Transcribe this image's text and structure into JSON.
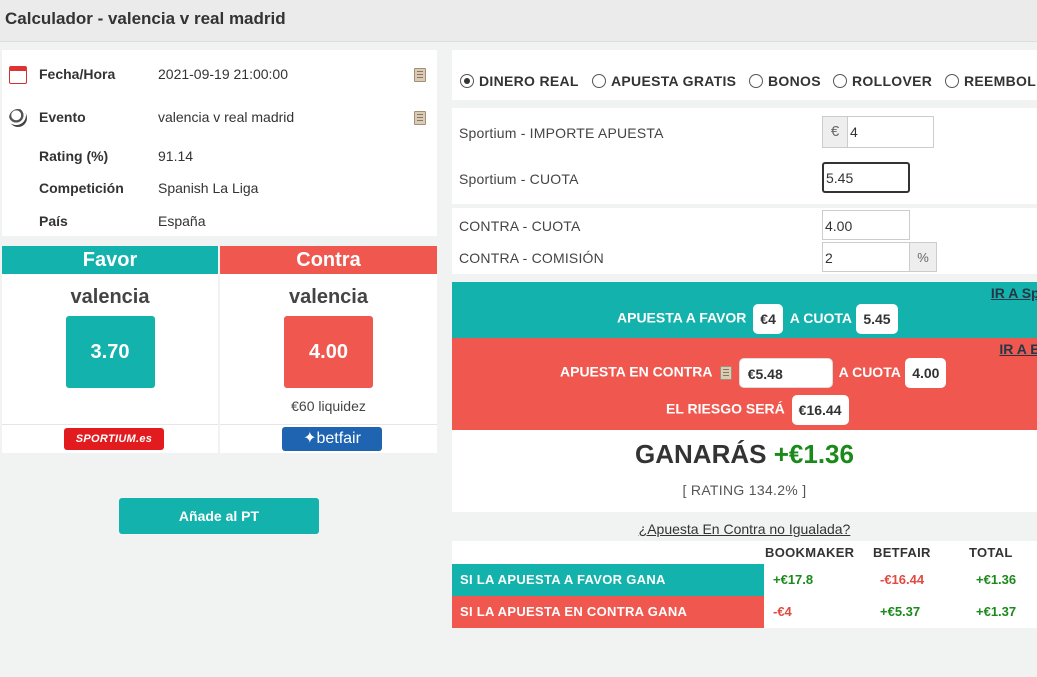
{
  "window": {
    "title": "Calculador - valencia v real madrid"
  },
  "info": {
    "fecha_label": "Fecha/Hora",
    "fecha_value": "2021-09-19 21:00:00",
    "evento_label": "Evento",
    "evento_value": "valencia v real madrid",
    "rating_label": "Rating (%)",
    "rating_value": "91.14",
    "competicion_label": "Competición",
    "competicion_value": "Spanish La Liga",
    "pais_label": "País",
    "pais_value": "España"
  },
  "favor": {
    "header": "Favor",
    "team": "valencia",
    "odd": "3.70",
    "bookmaker_logo": "SPORTIUM.es",
    "bookmaker_icon": "sportium-logo"
  },
  "contra": {
    "header": "Contra",
    "team": "valencia",
    "odd": "4.00",
    "liquidity": "€60 liquidez",
    "exchange_logo": "betfair",
    "exchange_icon": "betfair-logo"
  },
  "add_button": "Añade al PT",
  "modes": [
    {
      "label": "DINERO REAL",
      "selected": true
    },
    {
      "label": "APUESTA GRATIS",
      "selected": false
    },
    {
      "label": "BONOS",
      "selected": false
    },
    {
      "label": "ROLLOVER",
      "selected": false
    },
    {
      "label": "REEMBOL",
      "selected": false
    }
  ],
  "form": {
    "importe_label": "Sportium - IMPORTE APUESTA",
    "currency": "€",
    "importe_value": "4",
    "cuota_label": "Sportium - CUOTA",
    "cuota_value": "5.45",
    "contra_cuota_label": "CONTRA - CUOTA",
    "contra_cuota_value": "4.00",
    "comision_label": "CONTRA - COMISIÓN",
    "comision_value": "2",
    "comision_unit": "%"
  },
  "ir_sportium": {
    "link": "IR A Sportium",
    "favor_label": "APUESTA A FAVOR",
    "favor_stake": "€4",
    "cuota_label": "A CUOTA",
    "cuota_value": "5.45"
  },
  "ir_betfair": {
    "link": "IR A Betfair",
    "contra_label": "APUESTA EN CONTRA",
    "contra_stake": "€5.48",
    "cuota_label": "A CUOTA",
    "cuota_value": "4.00",
    "riesgo_label": "EL RIESGO SERÁ",
    "riesgo_value": "€16.44"
  },
  "result": {
    "ganaras_label": "GANARÁS",
    "ganaras_value": "+€1.36",
    "rating": "[ RATING 134.2% ]"
  },
  "no_igualada_link": "¿Apuesta En Contra no Igualada?",
  "table": {
    "headers": [
      "BOOKMAKER",
      "BETFAIR",
      "TOTAL"
    ],
    "rows": [
      {
        "label": "SI LA APUESTA A FAVOR GANA",
        "bookmaker": "+€17.8",
        "betfair": "-€16.44",
        "total": "+€1.36"
      },
      {
        "label": "SI LA APUESTA EN CONTRA GANA",
        "bookmaker": "-€4",
        "betfair": "+€5.37",
        "total": "+€1.37"
      }
    ]
  },
  "colors": {
    "accent_green": "#13b2ac",
    "accent_red": "#f0584f",
    "positive": "#1a8a1a",
    "negative": "#e04a40"
  }
}
